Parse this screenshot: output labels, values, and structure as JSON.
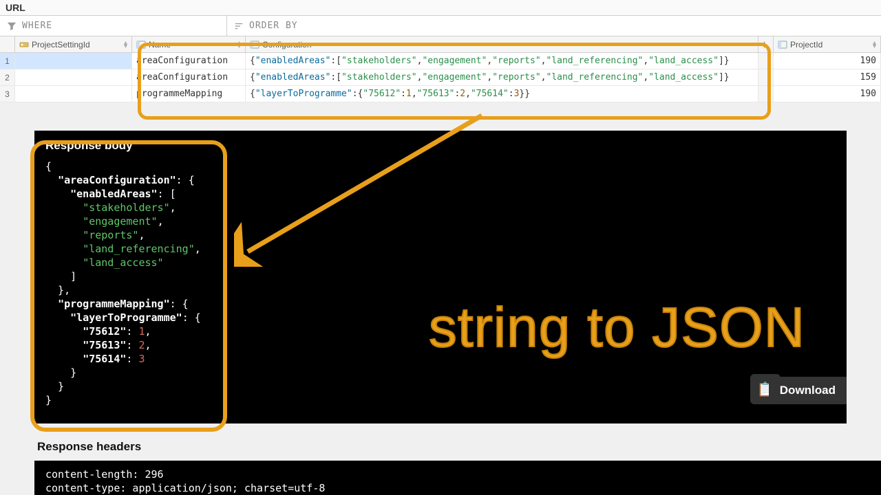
{
  "topbar": {
    "title": "URL"
  },
  "filters": {
    "where_label": "WHERE",
    "orderby_label": "ORDER BY"
  },
  "columns": {
    "psid": "ProjectSettingId",
    "name": "Name",
    "config": "Configuration",
    "pid": "ProjectId"
  },
  "rows": [
    {
      "psid": "",
      "name": "areaConfiguration",
      "config": {
        "raw": "{\"enabledAreas\":[\"stakeholders\",\"engagement\",\"reports\",\"land_referencing\",\"land_access\"]}",
        "parts": [
          {
            "t": "p",
            "v": "{"
          },
          {
            "t": "k",
            "v": "\"enabledAreas\""
          },
          {
            "t": "p",
            "v": ":["
          },
          {
            "t": "s",
            "v": "\"stakeholders\""
          },
          {
            "t": "p",
            "v": ","
          },
          {
            "t": "s",
            "v": "\"engagement\""
          },
          {
            "t": "p",
            "v": ","
          },
          {
            "t": "s",
            "v": "\"reports\""
          },
          {
            "t": "p",
            "v": ","
          },
          {
            "t": "s",
            "v": "\"land_referencing\""
          },
          {
            "t": "p",
            "v": ","
          },
          {
            "t": "s",
            "v": "\"land_access\""
          },
          {
            "t": "p",
            "v": "]}"
          }
        ]
      },
      "pid": "190"
    },
    {
      "psid": "",
      "name": "areaConfiguration",
      "config": {
        "raw": "{\"enabledAreas\":[\"stakeholders\",\"engagement\",\"reports\",\"land_referencing\",\"land_access\"]}",
        "parts": [
          {
            "t": "p",
            "v": "{"
          },
          {
            "t": "k",
            "v": "\"enabledAreas\""
          },
          {
            "t": "p",
            "v": ":["
          },
          {
            "t": "s",
            "v": "\"stakeholders\""
          },
          {
            "t": "p",
            "v": ","
          },
          {
            "t": "s",
            "v": "\"engagement\""
          },
          {
            "t": "p",
            "v": ","
          },
          {
            "t": "s",
            "v": "\"reports\""
          },
          {
            "t": "p",
            "v": ","
          },
          {
            "t": "s",
            "v": "\"land_referencing\""
          },
          {
            "t": "p",
            "v": ","
          },
          {
            "t": "s",
            "v": "\"land_access\""
          },
          {
            "t": "p",
            "v": "]}"
          }
        ]
      },
      "pid": "159"
    },
    {
      "psid": "",
      "name": "programmeMapping",
      "config": {
        "raw": "{\"layerToProgramme\":{\"75612\":1,\"75613\":2,\"75614\":3}}",
        "parts": [
          {
            "t": "p",
            "v": "{"
          },
          {
            "t": "k",
            "v": "\"layerToProgramme\""
          },
          {
            "t": "p",
            "v": ":{"
          },
          {
            "t": "s",
            "v": "\"75612\""
          },
          {
            "t": "p",
            "v": ":"
          },
          {
            "t": "n",
            "v": "1"
          },
          {
            "t": "p",
            "v": ","
          },
          {
            "t": "s",
            "v": "\"75613\""
          },
          {
            "t": "p",
            "v": ":"
          },
          {
            "t": "n",
            "v": "2"
          },
          {
            "t": "p",
            "v": ","
          },
          {
            "t": "s",
            "v": "\"75614\""
          },
          {
            "t": "p",
            "v": ":"
          },
          {
            "t": "n",
            "v": "3"
          },
          {
            "t": "p",
            "v": "}}"
          }
        ]
      },
      "pid": "190"
    }
  ],
  "response": {
    "title": "Response body",
    "lines": [
      [
        {
          "t": "p",
          "v": "{"
        }
      ],
      [
        {
          "t": "p",
          "v": "  "
        },
        {
          "t": "k",
          "v": "\"areaConfiguration\""
        },
        {
          "t": "p",
          "v": ": {"
        }
      ],
      [
        {
          "t": "p",
          "v": "    "
        },
        {
          "t": "k",
          "v": "\"enabledAreas\""
        },
        {
          "t": "p",
          "v": ": ["
        }
      ],
      [
        {
          "t": "p",
          "v": "      "
        },
        {
          "t": "s",
          "v": "\"stakeholders\""
        },
        {
          "t": "p",
          "v": ","
        }
      ],
      [
        {
          "t": "p",
          "v": "      "
        },
        {
          "t": "s",
          "v": "\"engagement\""
        },
        {
          "t": "p",
          "v": ","
        }
      ],
      [
        {
          "t": "p",
          "v": "      "
        },
        {
          "t": "s",
          "v": "\"reports\""
        },
        {
          "t": "p",
          "v": ","
        }
      ],
      [
        {
          "t": "p",
          "v": "      "
        },
        {
          "t": "s",
          "v": "\"land_referencing\""
        },
        {
          "t": "p",
          "v": ","
        }
      ],
      [
        {
          "t": "p",
          "v": "      "
        },
        {
          "t": "s",
          "v": "\"land_access\""
        }
      ],
      [
        {
          "t": "p",
          "v": "    ]"
        }
      ],
      [
        {
          "t": "p",
          "v": "  },"
        }
      ],
      [
        {
          "t": "p",
          "v": "  "
        },
        {
          "t": "k",
          "v": "\"programmeMapping\""
        },
        {
          "t": "p",
          "v": ": {"
        }
      ],
      [
        {
          "t": "p",
          "v": "    "
        },
        {
          "t": "k",
          "v": "\"layerToProgramme\""
        },
        {
          "t": "p",
          "v": ": {"
        }
      ],
      [
        {
          "t": "p",
          "v": "      "
        },
        {
          "t": "k",
          "v": "\"75612\""
        },
        {
          "t": "p",
          "v": ": "
        },
        {
          "t": "n",
          "v": "1"
        },
        {
          "t": "p",
          "v": ","
        }
      ],
      [
        {
          "t": "p",
          "v": "      "
        },
        {
          "t": "k",
          "v": "\"75613\""
        },
        {
          "t": "p",
          "v": ": "
        },
        {
          "t": "n",
          "v": "2"
        },
        {
          "t": "p",
          "v": ","
        }
      ],
      [
        {
          "t": "p",
          "v": "      "
        },
        {
          "t": "k",
          "v": "\"75614\""
        },
        {
          "t": "p",
          "v": ": "
        },
        {
          "t": "n",
          "v": "3"
        }
      ],
      [
        {
          "t": "p",
          "v": "    }"
        }
      ],
      [
        {
          "t": "p",
          "v": "  }"
        }
      ],
      [
        {
          "t": "p",
          "v": "}"
        }
      ]
    ]
  },
  "annotation": {
    "label": "string to JSON"
  },
  "buttons": {
    "download": "Download"
  },
  "response_headers": {
    "title": "Response headers",
    "lines": [
      "content-length: 296",
      "content-type: application/json; charset=utf-8"
    ]
  }
}
